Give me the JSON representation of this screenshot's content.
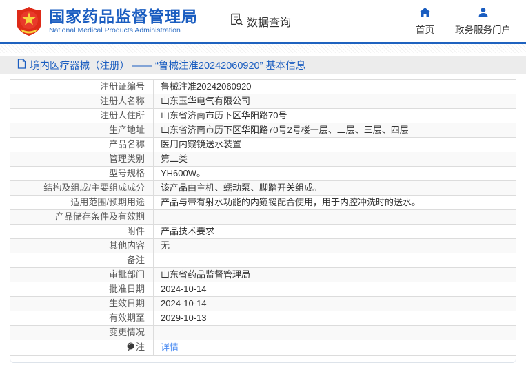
{
  "header": {
    "logo": {
      "title": "国家药品监督管理局",
      "subtitle": "National Medical Products Administration",
      "emblem_icon": "china-national-emblem"
    },
    "data_query": {
      "label": "数据查询",
      "icon": "document-search-icon"
    },
    "nav": [
      {
        "label": "首页",
        "icon": "home-icon"
      },
      {
        "label": "政务服务门户",
        "icon": "person-icon"
      }
    ]
  },
  "breadcrumb": {
    "icon": "document-icon",
    "text": "境内医疗器械（注册） —— “鲁械注准20242060920” 基本信息"
  },
  "table": {
    "rows": [
      {
        "label": "注册证编号",
        "value": "鲁械注准20242060920"
      },
      {
        "label": "注册人名称",
        "value": "山东玉华电气有限公司"
      },
      {
        "label": "注册人住所",
        "value": "山东省济南市历下区华阳路70号"
      },
      {
        "label": "生产地址",
        "value": "山东省济南市历下区华阳路70号2号楼一层、二层、三层、四层"
      },
      {
        "label": "产品名称",
        "value": "医用内窥镜送水装置"
      },
      {
        "label": "管理类别",
        "value": "第二类"
      },
      {
        "label": "型号规格",
        "value": "YH600W。"
      },
      {
        "label": "结构及组成/主要组成成分",
        "value": "该产品由主机、蠕动泵、脚踏开关组成。"
      },
      {
        "label": "适用范围/预期用途",
        "value": "产品与带有射水功能的内窥镜配合使用，用于内腔冲洗时的送水。"
      },
      {
        "label": "产品储存条件及有效期",
        "value": ""
      },
      {
        "label": "附件",
        "value": "产品技术要求"
      },
      {
        "label": "其他内容",
        "value": "无"
      },
      {
        "label": "备注",
        "value": ""
      },
      {
        "label": "审批部门",
        "value": "山东省药品监督管理局"
      },
      {
        "label": "批准日期",
        "value": "2024-10-14"
      },
      {
        "label": "生效日期",
        "value": "2024-10-14"
      },
      {
        "label": "有效期至",
        "value": "2029-10-13"
      },
      {
        "label": "变更情况",
        "value": ""
      },
      {
        "label": "注",
        "label_icon": "note-icon",
        "value": "详情",
        "value_is_link": true
      }
    ]
  },
  "colors": {
    "accent_blue": "#1a5dc0",
    "header_rule_blue": "#1e62bf",
    "link_blue": "#4d8df2",
    "emblem_red": "#de2a18",
    "emblem_gold": "#f7d53e",
    "breadcrumb_bg": "#ececec"
  }
}
